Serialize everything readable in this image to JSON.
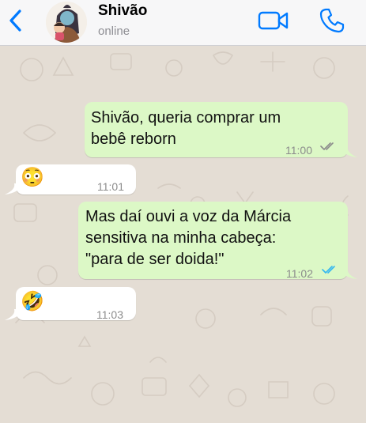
{
  "contact": {
    "name": "Shivão",
    "status": "online"
  },
  "colors": {
    "accent": "#007aff",
    "outgoing_bubble": "#dcf8c6",
    "incoming_bubble": "#ffffff",
    "read_ticks": "#34b7f1",
    "delivered_ticks": "#8c8c8c"
  },
  "messages": [
    {
      "direction": "out",
      "text": "Shivão, queria comprar um\nbebê reborn",
      "time": "11:00",
      "ticks": "delivered"
    },
    {
      "direction": "in",
      "emoji": "😳",
      "time": "11:01"
    },
    {
      "direction": "out",
      "text": "Mas daí ouvi a voz da Márcia\nsensitiva na minha cabeça:\n\"para de ser doida!\"",
      "time": "11:02",
      "ticks": "read"
    },
    {
      "direction": "in",
      "emoji": "🤣",
      "time": "11:03"
    }
  ]
}
